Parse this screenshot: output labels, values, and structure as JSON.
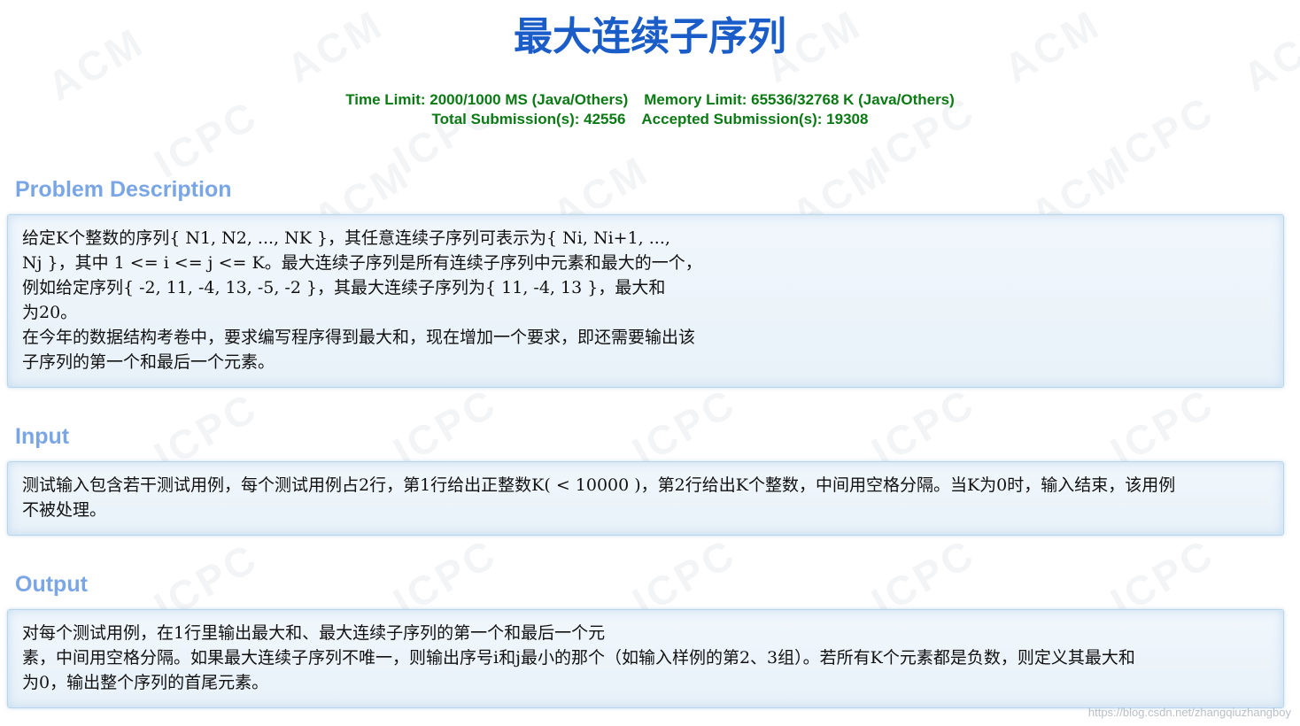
{
  "problem": {
    "title": "最大连续子序列",
    "limits": {
      "time_limit": "Time Limit: 2000/1000 MS (Java/Others)",
      "memory_limit": "Memory Limit: 65536/32768 K (Java/Others)",
      "total_submissions": "Total Submission(s): 42556",
      "accepted_submissions": "Accepted Submission(s): 19308"
    }
  },
  "sections": {
    "description": {
      "heading": "Problem Description",
      "lines": [
        "给定K个整数的序列{ N1, N2, ..., NK }，其任意连续子序列可表示为{ Ni, Ni+1, ...,",
        "Nj }，其中 1 <= i <= j <= K。最大连续子序列是所有连续子序列中元素和最大的一个，",
        "例如给定序列{ -2, 11, -4, 13, -5, -2 }，其最大连续子序列为{ 11, -4, 13 }，最大和",
        "为20。",
        "在今年的数据结构考卷中，要求编写程序得到最大和，现在增加一个要求，即还需要输出该",
        "子序列的第一个和最后一个元素。"
      ]
    },
    "input": {
      "heading": "Input",
      "lines": [
        "测试输入包含若干测试用例，每个测试用例占2行，第1行给出正整数K( < 10000 )，第2行给出K个整数，中间用空格分隔。当K为0时，输入结束，该用例",
        "不被处理。"
      ]
    },
    "output": {
      "heading": "Output",
      "lines": [
        "对每个测试用例，在1行里输出最大和、最大连续子序列的第一个和最后一个元",
        "素，中间用空格分隔。如果最大连续子序列不唯一，则输出序号i和j最小的那个（如输入样例的第2、3组）。若所有K个元素都是负数，则定义其最大和",
        "为0，输出整个序列的首尾元素。"
      ]
    }
  },
  "watermark": {
    "text_acm": "ACM",
    "text_icpc": "ICPC",
    "credit": "https://blog.csdn.net/zhangqiuzhangboy"
  },
  "colors": {
    "title": "#1a5cc8",
    "meta": "#0b7a14",
    "section_heading": "#7aa6e6",
    "panel_border": "#b9d6ea"
  }
}
